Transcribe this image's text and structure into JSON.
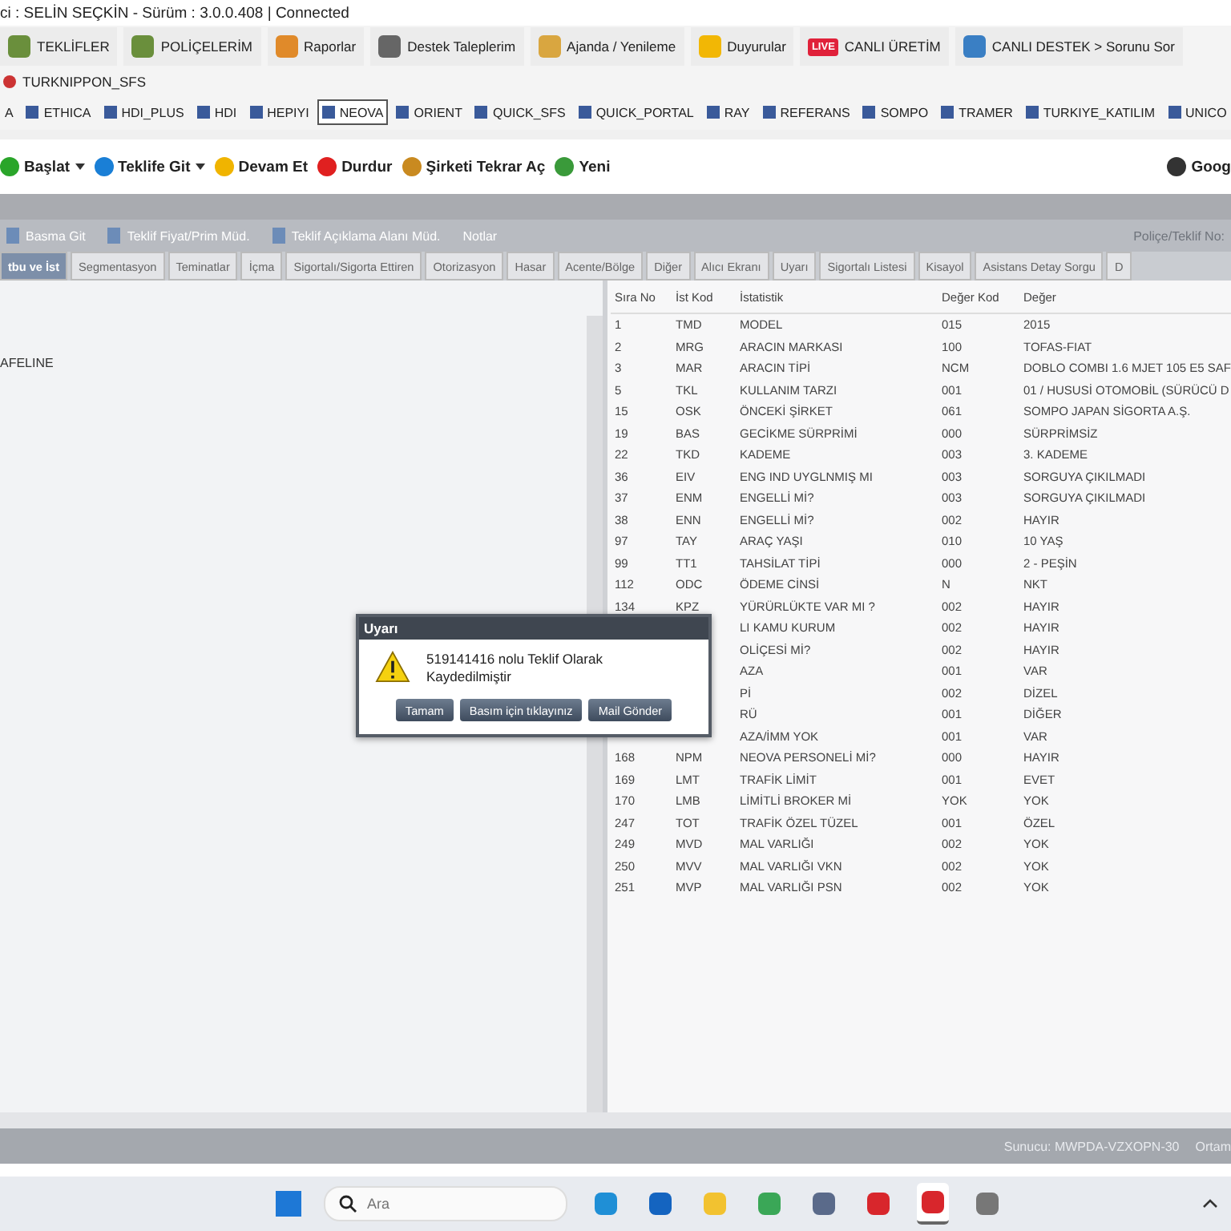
{
  "title_bar": {
    "text": "ci : SELİN SEÇKİN - Sürüm : 3.0.0.408 | Connected"
  },
  "menu": [
    {
      "label": "TEKLİFLER"
    },
    {
      "label": "POLİÇELERİM"
    },
    {
      "label": "Raporlar"
    },
    {
      "label": "Destek Taleplerim"
    },
    {
      "label": "Ajanda / Yenileme"
    },
    {
      "label": "Duyurular"
    },
    {
      "label": "CANLI ÜRETİM",
      "badge": "LIVE"
    },
    {
      "label": "CANLI DESTEK > Sorunu Sor"
    }
  ],
  "sub_menu": [
    {
      "label": "TURKNIPPON_SFS"
    }
  ],
  "companies": [
    {
      "label": "A",
      "selected": false
    },
    {
      "label": "ETHICA",
      "selected": false
    },
    {
      "label": "HDI_PLUS",
      "selected": false
    },
    {
      "label": "HDI",
      "selected": false
    },
    {
      "label": "HEPIYI",
      "selected": false
    },
    {
      "label": "NEOVA",
      "selected": true
    },
    {
      "label": "ORIENT",
      "selected": false
    },
    {
      "label": "QUICK_SFS",
      "selected": false
    },
    {
      "label": "QUICK_PORTAL",
      "selected": false
    },
    {
      "label": "RAY",
      "selected": false
    },
    {
      "label": "REFERANS",
      "selected": false
    },
    {
      "label": "SOMPO",
      "selected": false
    },
    {
      "label": "TRAMER",
      "selected": false
    },
    {
      "label": "TURKIYE_KATILIM",
      "selected": false
    },
    {
      "label": "UNICO",
      "selected": false
    }
  ],
  "actions": [
    {
      "label": "Başlat",
      "dropdown": true
    },
    {
      "label": "Teklife Git",
      "dropdown": true
    },
    {
      "label": "Devam Et",
      "dropdown": false
    },
    {
      "label": "Durdur",
      "dropdown": false
    },
    {
      "label": "Şirketi Tekrar Aç",
      "dropdown": false
    },
    {
      "label": "Yeni",
      "dropdown": false
    }
  ],
  "actions_right": "Goog",
  "form_toolbar": [
    {
      "label": "Basma Git",
      "disabled": false
    },
    {
      "label": "Teklif Fiyat/Prim Müd.",
      "disabled": false
    },
    {
      "label": "Teklif Açıklama Alanı Müd.",
      "disabled": false
    },
    {
      "label": "Notlar",
      "disabled": false
    },
    {
      "label": "Poliçe/Teklif No:",
      "disabled": true
    }
  ],
  "tabs": [
    {
      "label": "tbu ve İst",
      "selected": true
    },
    {
      "label": "Segmentasyon",
      "selected": false
    },
    {
      "label": "Teminatlar",
      "selected": false
    },
    {
      "label": "İçma",
      "selected": false
    },
    {
      "label": "Sigortalı/Sigorta Ettiren",
      "selected": false
    },
    {
      "label": "Otorizasyon",
      "selected": false
    },
    {
      "label": "Hasar",
      "selected": false
    },
    {
      "label": "Acente/Bölge",
      "selected": false
    },
    {
      "label": "Diğer",
      "selected": false
    },
    {
      "label": "Alıcı Ekranı",
      "selected": false
    },
    {
      "label": "Uyarı",
      "selected": false
    },
    {
      "label": "Sigortalı Listesi",
      "selected": false
    },
    {
      "label": "Kisayol",
      "selected": false
    },
    {
      "label": "Asistans Detay Sorgu",
      "selected": false
    },
    {
      "label": "D",
      "selected": false
    }
  ],
  "left_panel": {
    "items": [
      "AFELINE"
    ]
  },
  "table": {
    "columns": [
      "Sıra No",
      "İst Kod",
      "İstatistik",
      "Değer Kod",
      "Değer"
    ],
    "rows": [
      {
        "sira_no": "1",
        "ist_kod": "TMD",
        "istatistik": "MODEL",
        "deger_kod": "015",
        "deger": "2015"
      },
      {
        "sira_no": "2",
        "ist_kod": "MRG",
        "istatistik": "ARACIN MARKASI",
        "deger_kod": "100",
        "deger": "TOFAS-FIAT"
      },
      {
        "sira_no": "3",
        "ist_kod": "MAR",
        "istatistik": "ARACIN TİPİ",
        "deger_kod": "NCM",
        "deger": "DOBLO COMBI 1.6 MJET 105 E5 SAF"
      },
      {
        "sira_no": "5",
        "ist_kod": "TKL",
        "istatistik": "KULLANIM TARZI",
        "deger_kod": "001",
        "deger": "01 / HUSUSİ OTOMOBİL (SÜRÜCÜ D"
      },
      {
        "sira_no": "15",
        "ist_kod": "OSK",
        "istatistik": "ÖNCEKİ ŞİRKET",
        "deger_kod": "061",
        "deger": "SOMPO JAPAN SİGORTA A.Ş."
      },
      {
        "sira_no": "19",
        "ist_kod": "BAS",
        "istatistik": "GECİKME SÜRPRİMİ",
        "deger_kod": "000",
        "deger": "SÜRPRİMSİZ"
      },
      {
        "sira_no": "22",
        "ist_kod": "TKD",
        "istatistik": "KADEME",
        "deger_kod": "003",
        "deger": "3. KADEME"
      },
      {
        "sira_no": "36",
        "ist_kod": "EIV",
        "istatistik": "ENG IND UYGLNMIŞ MI",
        "deger_kod": "003",
        "deger": "SORGUYA ÇIKILMADI"
      },
      {
        "sira_no": "37",
        "ist_kod": "ENM",
        "istatistik": "ENGELLİ Mİ?",
        "deger_kod": "003",
        "deger": "SORGUYA ÇIKILMADI"
      },
      {
        "sira_no": "38",
        "ist_kod": "ENN",
        "istatistik": "ENGELLİ Mİ?",
        "deger_kod": "002",
        "deger": "HAYIR"
      },
      {
        "sira_no": "97",
        "ist_kod": "TAY",
        "istatistik": "ARAÇ YAŞI",
        "deger_kod": "010",
        "deger": "10 YAŞ"
      },
      {
        "sira_no": "99",
        "ist_kod": "TT1",
        "istatistik": "TAHSİLAT TİPİ",
        "deger_kod": "000",
        "deger": "2 - PEŞİN"
      },
      {
        "sira_no": "112",
        "ist_kod": "ODC",
        "istatistik": "ÖDEME CİNSİ",
        "deger_kod": "N",
        "deger": "NKT"
      },
      {
        "sira_no": "134",
        "ist_kod": "KPZ",
        "istatistik": "YÜRÜRLÜKTE VAR MI ?",
        "deger_kod": "002",
        "deger": "HAYIR"
      },
      {
        "istatistik": "LI KAMU KURUM",
        "deger_kod": "002",
        "deger": "HAYIR"
      },
      {
        "istatistik": "OLİÇESİ Mİ?",
        "deger_kod": "002",
        "deger": "HAYIR"
      },
      {
        "istatistik": "AZA",
        "deger_kod": "001",
        "deger": "VAR"
      },
      {
        "istatistik": "Pİ",
        "deger_kod": "002",
        "deger": "DİZEL"
      },
      {
        "istatistik": "RÜ",
        "deger_kod": "001",
        "deger": "DİĞER"
      },
      {
        "istatistik": "AZA/İMM YOK",
        "deger_kod": "001",
        "deger": "VAR"
      },
      {
        "sira_no": "168",
        "ist_kod": "NPM",
        "istatistik": "NEOVA PERSONELİ Mİ?",
        "deger_kod": "000",
        "deger": "HAYIR"
      },
      {
        "sira_no": "169",
        "ist_kod": "LMT",
        "istatistik": "TRAFİK LİMİT",
        "deger_kod": "001",
        "deger": "EVET"
      },
      {
        "sira_no": "170",
        "ist_kod": "LMB",
        "istatistik": "LİMİTLİ BROKER Mİ",
        "deger_kod": "YOK",
        "deger": "YOK"
      },
      {
        "sira_no": "247",
        "ist_kod": "TOT",
        "istatistik": "TRAFİK ÖZEL TÜZEL",
        "deger_kod": "001",
        "deger": "ÖZEL"
      },
      {
        "sira_no": "249",
        "ist_kod": "MVD",
        "istatistik": "MAL VARLIĞI",
        "deger_kod": "002",
        "deger": "YOK"
      },
      {
        "sira_no": "250",
        "ist_kod": "MVV",
        "istatistik": "MAL VARLIĞI VKN",
        "deger_kod": "002",
        "deger": "YOK"
      },
      {
        "sira_no": "251",
        "ist_kod": "MVP",
        "istatistik": "MAL VARLIĞI PSN",
        "deger_kod": "002",
        "deger": "YOK"
      }
    ]
  },
  "dialog": {
    "title": "Uyarı",
    "message": "519141416 nolu Teklif Olarak Kaydedilmiştir",
    "buttons": [
      "Tamam",
      "Basım için tıklayınız",
      "Mail Gönder"
    ]
  },
  "status_bar": {
    "server": "Sunucu: MWPDA-VZXOPN-30",
    "env": "Ortam"
  },
  "taskbar": {
    "search": {
      "placeholder": "Ara"
    },
    "apps": [
      {
        "active": false
      },
      {
        "active": false
      },
      {
        "active": false
      },
      {
        "active": false
      },
      {
        "active": false
      },
      {
        "active": false
      },
      {
        "active": true
      },
      {
        "active": false
      }
    ]
  }
}
